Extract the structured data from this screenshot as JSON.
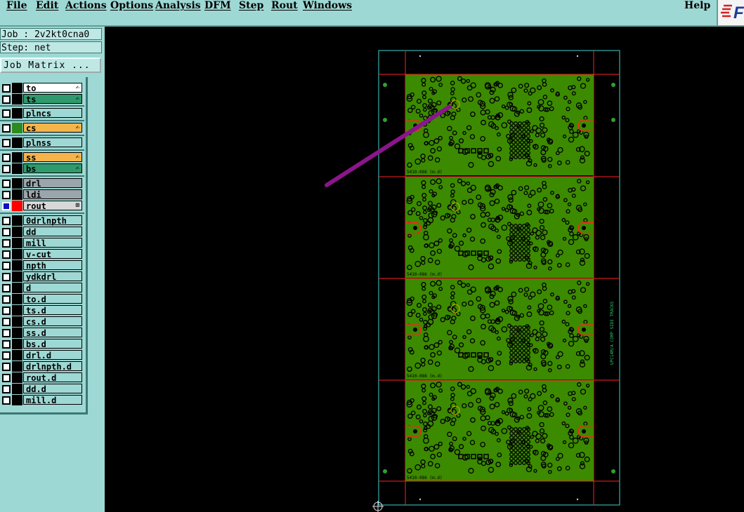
{
  "menubar": {
    "items": [
      {
        "label": "File"
      },
      {
        "label": "Edit"
      },
      {
        "label": "Actions"
      },
      {
        "label": "Options"
      },
      {
        "label": "Analysis"
      },
      {
        "label": "DFM"
      },
      {
        "label": "Step"
      },
      {
        "label": "Rout"
      },
      {
        "label": "Windows"
      }
    ],
    "help": "Help"
  },
  "panel": {
    "job": "Job : 2v2kt0cna0",
    "step": "Step: net",
    "job_matrix_button": "Job Matrix ..."
  },
  "layers": [
    {
      "name": "to",
      "bg": "#ffffff",
      "swatch": "#000000",
      "icon": "edit-hand-icon"
    },
    {
      "name": "ts",
      "bg": "#2f9a6e",
      "swatch": "#000000",
      "icon": "edit-hand-icon"
    },
    {
      "name": "plncs",
      "bg": "#9ed8d4",
      "swatch": "#000000"
    },
    {
      "name": "cs",
      "bg": "#f5b44a",
      "swatch": "#2d8a1f",
      "icon": "edit-hand-icon"
    },
    {
      "name": "plnss",
      "bg": "#9ed8d4",
      "swatch": "#000000"
    },
    {
      "name": "ss",
      "bg": "#f5b44a",
      "swatch": "#000000",
      "icon": "edit-hand-icon"
    },
    {
      "name": "bs",
      "bg": "#2f9a6e",
      "swatch": "#000000",
      "icon": "edit-hand-icon"
    },
    {
      "name": "drl",
      "bg": "#9aa6ab",
      "swatch": "#000000"
    },
    {
      "name": "ldi",
      "bg": "#9aa6ab",
      "swatch": "#000000"
    },
    {
      "name": "rout",
      "bg": "#d8d8d8",
      "swatch": "#ff0000",
      "checked": true,
      "icon": "grid-icon"
    },
    {
      "name": "0drlnpth",
      "bg": "#9ed8d4",
      "swatch": "#000000"
    },
    {
      "name": "dd",
      "bg": "#9ed8d4",
      "swatch": "#000000"
    },
    {
      "name": "mill",
      "bg": "#9ed8d4",
      "swatch": "#000000"
    },
    {
      "name": "v-cut",
      "bg": "#9ed8d4",
      "swatch": "#000000"
    },
    {
      "name": "npth",
      "bg": "#9ed8d4",
      "swatch": "#000000"
    },
    {
      "name": "ydkdrl",
      "bg": "#9ed8d4",
      "swatch": "#000000"
    },
    {
      "name": "d",
      "bg": "#9ed8d4",
      "swatch": "#000000"
    },
    {
      "name": "to.d",
      "bg": "#9ed8d4",
      "swatch": "#000000"
    },
    {
      "name": "ts.d",
      "bg": "#9ed8d4",
      "swatch": "#000000"
    },
    {
      "name": "cs.d",
      "bg": "#9ed8d4",
      "swatch": "#000000"
    },
    {
      "name": "ss.d",
      "bg": "#9ed8d4",
      "swatch": "#000000"
    },
    {
      "name": "bs.d",
      "bg": "#9ed8d4",
      "swatch": "#000000"
    },
    {
      "name": "drl.d",
      "bg": "#9ed8d4",
      "swatch": "#000000"
    },
    {
      "name": "drlnpth.d",
      "bg": "#9ed8d4",
      "swatch": "#000000"
    },
    {
      "name": "rout.d",
      "bg": "#9ed8d4",
      "swatch": "#000000"
    },
    {
      "name": "dd.d",
      "bg": "#9ed8d4",
      "swatch": "#000000"
    },
    {
      "name": "mill.d",
      "bg": "#9ed8d4",
      "swatch": "#000000"
    }
  ],
  "board": {
    "panel_labels": [
      "5410-086 (m.d)",
      "5410-086 (m.d)",
      "5410-086 (m.d)",
      "5410-086 (m.d)"
    ],
    "side_text": "UPC14M/A COMP SIDE TRACKS",
    "colors": {
      "copper": "#3c8a00",
      "outline": "#ff2020",
      "frame": "#40d0d0",
      "arrow": "#8a168a",
      "pads": "#000000"
    }
  }
}
